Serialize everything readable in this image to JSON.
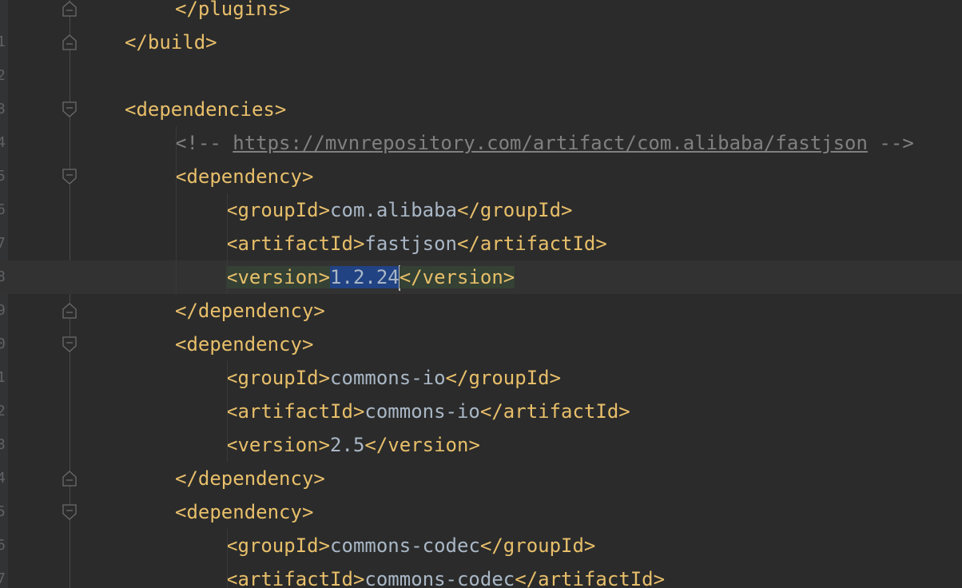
{
  "editor": {
    "lines": [
      {
        "indent": 3,
        "parts": [
          {
            "t": "</plugins>",
            "c": "tag"
          }
        ]
      },
      {
        "indent": 2,
        "parts": [
          {
            "t": "</build>",
            "c": "tag"
          }
        ]
      },
      {
        "indent": 0,
        "parts": []
      },
      {
        "indent": 2,
        "parts": [
          {
            "t": "<dependencies>",
            "c": "tag"
          }
        ]
      },
      {
        "indent": 3,
        "parts": [
          {
            "t": "<!-- ",
            "c": "comment"
          },
          {
            "t": "https://mvnrepository.com/artifact/com.alibaba/fastjson",
            "c": "link"
          },
          {
            "t": " -->",
            "c": "comment"
          }
        ]
      },
      {
        "indent": 3,
        "parts": [
          {
            "t": "<dependency>",
            "c": "tag"
          }
        ]
      },
      {
        "indent": 4,
        "parts": [
          {
            "t": "<groupId>",
            "c": "tag"
          },
          {
            "t": "com.alibaba",
            "c": "text"
          },
          {
            "t": "</groupId>",
            "c": "tag"
          }
        ]
      },
      {
        "indent": 4,
        "parts": [
          {
            "t": "<artifactId>",
            "c": "tag"
          },
          {
            "t": "fastjson",
            "c": "text"
          },
          {
            "t": "</artifactId>",
            "c": "tag"
          }
        ]
      },
      {
        "indent": 4,
        "current": true,
        "parts": [
          {
            "t": "<version>",
            "c": "tag",
            "hl": "tag"
          },
          {
            "t": "1.2.24",
            "c": "text",
            "hl": "sel",
            "caret": true
          },
          {
            "t": "</version>",
            "c": "tag",
            "hl": "tag"
          }
        ]
      },
      {
        "indent": 3,
        "parts": [
          {
            "t": "</dependency>",
            "c": "tag"
          }
        ]
      },
      {
        "indent": 3,
        "parts": [
          {
            "t": "<dependency>",
            "c": "tag"
          }
        ]
      },
      {
        "indent": 4,
        "parts": [
          {
            "t": "<groupId>",
            "c": "tag"
          },
          {
            "t": "commons-io",
            "c": "text"
          },
          {
            "t": "</groupId>",
            "c": "tag"
          }
        ]
      },
      {
        "indent": 4,
        "parts": [
          {
            "t": "<artifactId>",
            "c": "tag"
          },
          {
            "t": "commons-io",
            "c": "text"
          },
          {
            "t": "</artifactId>",
            "c": "tag"
          }
        ]
      },
      {
        "indent": 4,
        "parts": [
          {
            "t": "<version>",
            "c": "tag"
          },
          {
            "t": "2.5",
            "c": "text"
          },
          {
            "t": "</version>",
            "c": "tag"
          }
        ]
      },
      {
        "indent": 3,
        "parts": [
          {
            "t": "</dependency>",
            "c": "tag"
          }
        ]
      },
      {
        "indent": 3,
        "parts": [
          {
            "t": "<dependency>",
            "c": "tag"
          }
        ]
      },
      {
        "indent": 4,
        "parts": [
          {
            "t": "<groupId>",
            "c": "tag"
          },
          {
            "t": "commons-codec",
            "c": "text"
          },
          {
            "t": "</groupId>",
            "c": "tag"
          }
        ]
      },
      {
        "indent": 4,
        "parts": [
          {
            "t": "<artifactId>",
            "c": "tag"
          },
          {
            "t": "commons-codec",
            "c": "text"
          },
          {
            "t": "</artifactId>",
            "c": "tag"
          }
        ]
      }
    ],
    "line_numbers": [
      "",
      "1",
      "2",
      "3",
      "4",
      "5",
      "6",
      "7",
      "8",
      "9",
      "0",
      "1",
      "2",
      "3",
      "4",
      "5",
      "6",
      "7"
    ],
    "fold_markers": [
      {
        "line": 0,
        "kind": "end"
      },
      {
        "line": 1,
        "kind": "end"
      },
      {
        "line": 3,
        "kind": "start"
      },
      {
        "line": 5,
        "kind": "start"
      },
      {
        "line": 9,
        "kind": "end"
      },
      {
        "line": 10,
        "kind": "start"
      },
      {
        "line": 14,
        "kind": "end"
      },
      {
        "line": 15,
        "kind": "start"
      }
    ],
    "colors": {
      "background": "#2b2b2b",
      "tag": "#e8bf6a",
      "text": "#a9b7c6",
      "comment": "#808080",
      "selection": "#214283",
      "matched_tag": "#344134",
      "current_line": "#323232"
    }
  }
}
